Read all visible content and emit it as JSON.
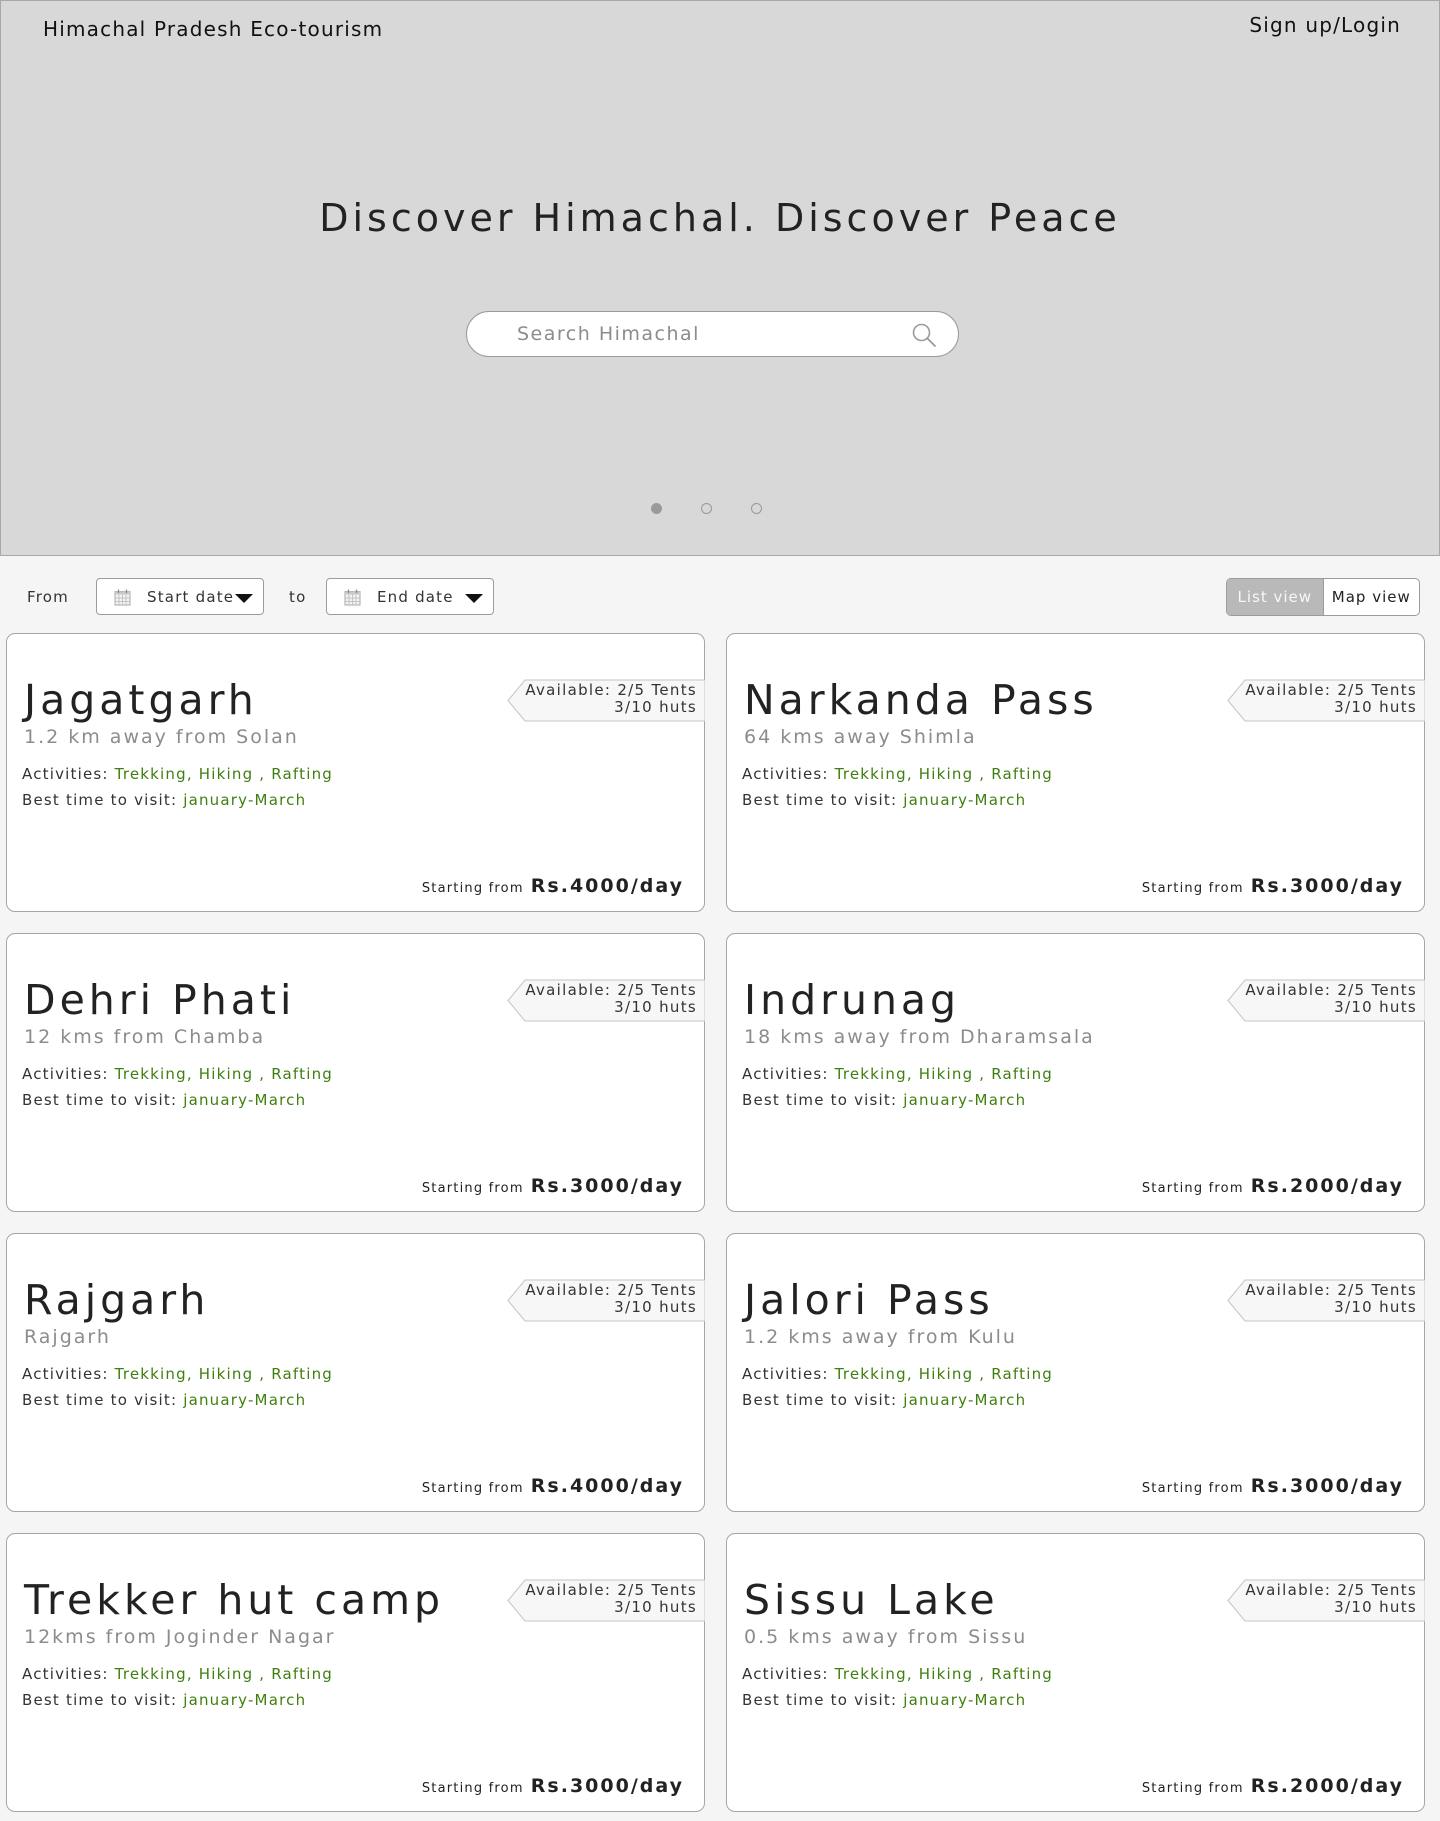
{
  "header": {
    "brand": "Himachal Pradesh Eco-tourism",
    "login_label": "Sign up/Login",
    "tagline": "Discover Himachal. Discover Peace",
    "search_placeholder": "Search Himachal",
    "carousel_pages": 3,
    "carousel_active": 1
  },
  "filters": {
    "from_label": "From",
    "start_date": "Start date",
    "to_label": "to",
    "end_date": "End date",
    "view_options": [
      "List view",
      "Map view"
    ],
    "active_view": "List view"
  },
  "card_labels": {
    "activities_label": "Activities: ",
    "best_time_label": "Best time to visit: ",
    "starting_from": "Starting from",
    "available_prefix": "Available: "
  },
  "colors": {
    "accent_green": "#3f7f0f",
    "hero_bg": "#d8d8d8",
    "page_bg": "#f5f5f5"
  },
  "destinations": [
    {
      "name": "Jagatgarh",
      "distance": "1.2 km away from Solan",
      "activities": "Trekking, Hiking , Rafting",
      "best_time": "january-March",
      "tents": "2/5 Tents",
      "huts": "3/10 huts",
      "price": "Rs.4000/day"
    },
    {
      "name": "Narkanda Pass",
      "distance": "64 kms away Shimla",
      "activities": "Trekking, Hiking , Rafting",
      "best_time": "january-March",
      "tents": "2/5 Tents",
      "huts": "3/10 huts",
      "price": "Rs.3000/day"
    },
    {
      "name": "Dehri Phati",
      "distance": "12 kms from Chamba",
      "activities": "Trekking, Hiking , Rafting",
      "best_time": "january-March",
      "tents": "2/5 Tents",
      "huts": "3/10 huts",
      "price": "Rs.3000/day"
    },
    {
      "name": "Indrunag",
      "distance": "18 kms away from Dharamsala",
      "activities": "Trekking, Hiking , Rafting",
      "best_time": "january-March",
      "tents": "2/5 Tents",
      "huts": "3/10 huts",
      "price": "Rs.2000/day"
    },
    {
      "name": "Rajgarh",
      "distance": "Rajgarh",
      "activities": "Trekking, Hiking , Rafting",
      "best_time": "january-March",
      "tents": "2/5 Tents",
      "huts": "3/10 huts",
      "price": "Rs.4000/day"
    },
    {
      "name": "Jalori Pass",
      "distance": "1.2 kms away from Kulu",
      "activities": "Trekking, Hiking , Rafting",
      "best_time": "january-March",
      "tents": "2/5 Tents",
      "huts": "3/10 huts",
      "price": "Rs.3000/day"
    },
    {
      "name": "Trekker hut camp",
      "distance": "12kms from Joginder Nagar",
      "activities": "Trekking, Hiking , Rafting",
      "best_time": "january-March",
      "tents": "2/5 Tents",
      "huts": "3/10 huts",
      "price": "Rs.3000/day"
    },
    {
      "name": "Sissu Lake",
      "distance": "0.5 kms away from Sissu",
      "activities": "Trekking, Hiking , Rafting",
      "best_time": "january-March",
      "tents": "2/5 Tents",
      "huts": "3/10 huts",
      "price": "Rs.2000/day"
    }
  ]
}
